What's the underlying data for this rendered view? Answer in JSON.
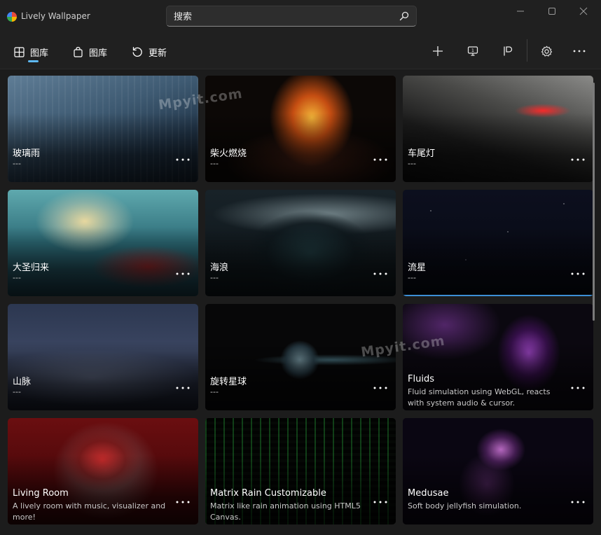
{
  "app": {
    "title": "Lively Wallpaper"
  },
  "search": {
    "placeholder": "搜索"
  },
  "nav": {
    "library_label": "图库",
    "gallery_label": "图库",
    "update_label": "更新"
  },
  "watermark": {
    "text": "Mpyit.com"
  },
  "wallpapers": [
    {
      "title": "玻璃雨",
      "desc": "---"
    },
    {
      "title": "柴火燃烧",
      "desc": "---"
    },
    {
      "title": "车尾灯",
      "desc": "---"
    },
    {
      "title": "大圣归来",
      "desc": "---"
    },
    {
      "title": "海浪",
      "desc": "---"
    },
    {
      "title": "流星",
      "desc": "---"
    },
    {
      "title": "山脉",
      "desc": "---"
    },
    {
      "title": "旋转星球",
      "desc": "---"
    },
    {
      "title": "Fluids",
      "desc": "Fluid simulation using WebGL, reacts with system audio & cursor."
    },
    {
      "title": "Living Room",
      "desc": "A lively room with music, visualizer and more!"
    },
    {
      "title": "Matrix Rain Customizable",
      "desc": "Matrix like rain animation using HTML5 Canvas."
    },
    {
      "title": "Medusae",
      "desc": "Soft body jellyfish simulation."
    }
  ],
  "colors": {
    "accent": "#5eb8f2",
    "selection": "#3c8fd6",
    "background": "#202020"
  }
}
